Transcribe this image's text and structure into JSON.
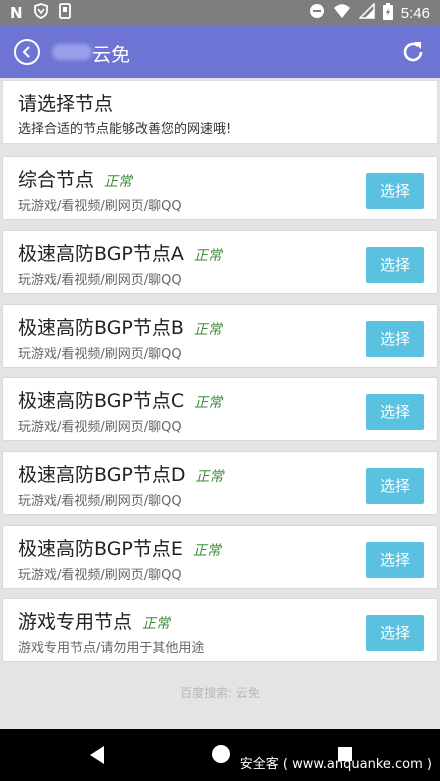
{
  "status_bar": {
    "time": "5:46",
    "left_glyph": "N"
  },
  "app_bar": {
    "title": "云免"
  },
  "header": {
    "title": "请选择节点",
    "subtitle": "选择合适的节点能够改善您的网速哦!"
  },
  "nodes": [
    {
      "name": "综合节点",
      "status": "正常",
      "desc": "玩游戏/看视频/刷网页/聊QQ",
      "button": "选择"
    },
    {
      "name": "极速高防BGP节点A",
      "status": "正常",
      "desc": "玩游戏/看视频/刷网页/聊QQ",
      "button": "选择"
    },
    {
      "name": "极速高防BGP节点B",
      "status": "正常",
      "desc": "玩游戏/看视频/刷网页/聊QQ",
      "button": "选择"
    },
    {
      "name": "极速高防BGP节点C",
      "status": "正常",
      "desc": "玩游戏/看视频/刷网页/聊QQ",
      "button": "选择"
    },
    {
      "name": "极速高防BGP节点D",
      "status": "正常",
      "desc": "玩游戏/看视频/刷网页/聊QQ",
      "button": "选择"
    },
    {
      "name": "极速高防BGP节点E",
      "status": "正常",
      "desc": "玩游戏/看视频/刷网页/聊QQ",
      "button": "选择"
    },
    {
      "name": "游戏专用节点",
      "status": "正常",
      "desc": "游戏专用节点/请勿用于其他用途",
      "button": "选择"
    }
  ],
  "footer": {
    "text": "百度搜索:   云免"
  },
  "watermark": "安全客 ( www.anquanke.com )",
  "colors": {
    "app_bar": "#6d74d4",
    "select_button": "#5ac2e0",
    "status_ok": "#3a8a3a"
  }
}
